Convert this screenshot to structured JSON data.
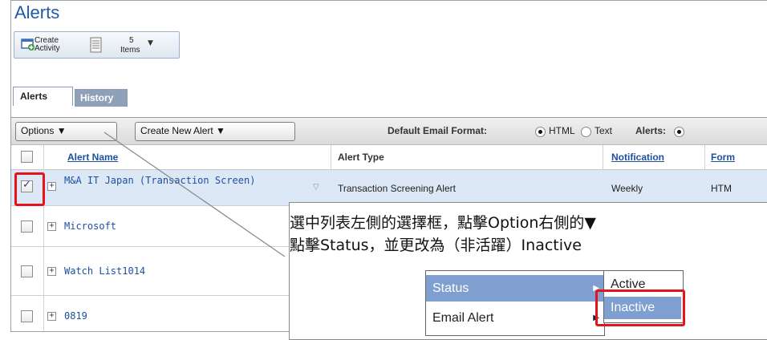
{
  "page_title": "Alerts",
  "toolbar": {
    "create_label": "Create\nActivity",
    "items_count": "5",
    "items_label": "Items"
  },
  "tabs": [
    {
      "label": "Alerts",
      "active": true
    },
    {
      "label": "History",
      "active": false
    }
  ],
  "actions": {
    "options_label": "Options ▼",
    "create_new_label": "Create New Alert ▼",
    "default_email_format_label": "Default Email Format:",
    "html_option": "HTML",
    "text_option": "Text",
    "alerts_label": "Alerts:"
  },
  "table": {
    "columns": [
      "Alert Name",
      "Alert Type",
      "Notification",
      "Form"
    ],
    "rows": [
      {
        "name": "M&A IT Japan (Transaction Screen)",
        "type": "Transaction Screening Alert",
        "notification": "Weekly",
        "format": "HTM",
        "checked": true
      },
      {
        "name": "Microsoft",
        "type": "",
        "notification": "",
        "format": "",
        "checked": false
      },
      {
        "name": "Watch List1014",
        "type": "",
        "notification": "",
        "format": "",
        "checked": false
      },
      {
        "name": "0819",
        "type": "",
        "notification": "",
        "format": "",
        "checked": false
      }
    ]
  },
  "callout": {
    "line1": "選中列表左側的選擇框，點擊Option右側的▼",
    "line2": "點擊Status，並更改為（非活躍）Inactive"
  },
  "menu": {
    "items": [
      "Status",
      "Email Alert"
    ],
    "submenu": [
      "Active",
      "Inactive"
    ]
  },
  "colors": {
    "link": "#1e4fa0",
    "highlight": "#e5141b",
    "menu_active": "#7f9fd0"
  }
}
